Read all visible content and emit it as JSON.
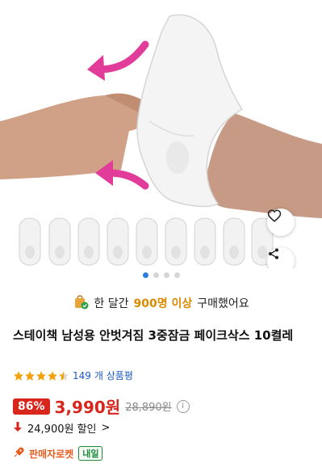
{
  "product": {
    "purchase_prefix": "한 달간",
    "purchase_count": "900명 이상",
    "purchase_suffix": "구매했어요",
    "title": "스테이책 남성용 안벗겨짐 3중잠금 페이크삭스 10켤레",
    "review_count": "149",
    "review_label": "개 상품평",
    "rating_fraction": 0.9,
    "discount": "86%",
    "price": "3,990원",
    "original_price": "28,890원",
    "coupon_text": "24,900원 할인",
    "coupon_chevron": ">",
    "rocket_label": "판매자로켓",
    "delivery_badge": "내일"
  },
  "carousel": {
    "pages": 4,
    "active_index": 0
  },
  "icons": {
    "wishlist": "heart-icon",
    "share": "share-icon",
    "bag": "shopping-bag-icon",
    "down": "arrow-down-icon",
    "info": "info-icon",
    "rocket": "rocket-icon"
  },
  "colors": {
    "price": "#d9261c",
    "highlight": "#d98a00",
    "link": "#1a5bc4",
    "dot_active": "#2a7de1"
  }
}
